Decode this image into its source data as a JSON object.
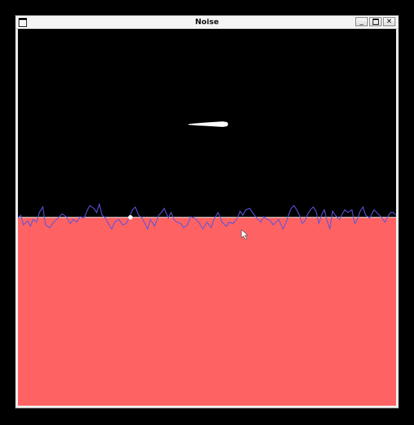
{
  "window": {
    "title": "Noise",
    "minimize_label": "_",
    "close_label": "✕"
  },
  "colors": {
    "sky": "#000000",
    "ground": "#ff6262",
    "noise_line": "#5a55dd",
    "horizon": "#ffffff",
    "cloud": "#ffffff"
  },
  "icons": {
    "app": "window-icon",
    "minimize": "minimize-icon",
    "maximize": "maximize-icon",
    "close": "close-icon",
    "pointer": "mouse-pointer-icon"
  }
}
